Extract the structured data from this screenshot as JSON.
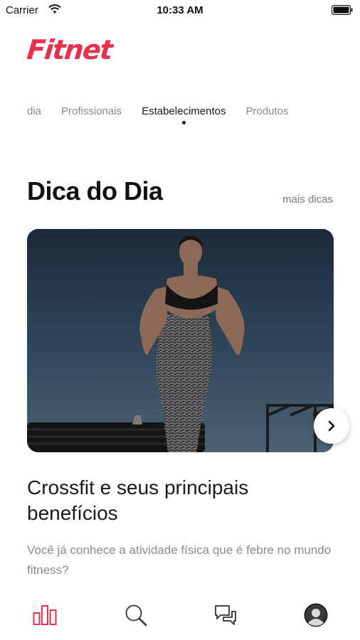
{
  "status_bar": {
    "carrier": "Carrier",
    "time": "10:33 AM",
    "wifi_icon": "wifi-icon",
    "battery_icon": "battery-icon"
  },
  "brand": {
    "logo_text": "Fitnet",
    "accent_color": "#e8304b"
  },
  "tabs": [
    {
      "label": "dia",
      "active": false
    },
    {
      "label": "Profissionais",
      "active": false
    },
    {
      "label": "Estabelecimentos",
      "active": true
    },
    {
      "label": "Produtos",
      "active": false
    }
  ],
  "section": {
    "title": "Dica do Dia",
    "more_link": "mais dicas"
  },
  "article": {
    "title": "Crossfit e seus principais benefícios",
    "description": "Você já conhece a atividade física que é febre no mundo fitness?",
    "next_icon": "chevron-right-icon"
  },
  "bottom_nav": [
    {
      "name": "stats",
      "icon": "bar-chart-icon",
      "active": true
    },
    {
      "name": "search",
      "icon": "search-icon",
      "active": false
    },
    {
      "name": "chat",
      "icon": "chat-bubbles-icon",
      "active": false
    },
    {
      "name": "profile",
      "icon": "avatar-icon",
      "active": false
    }
  ]
}
